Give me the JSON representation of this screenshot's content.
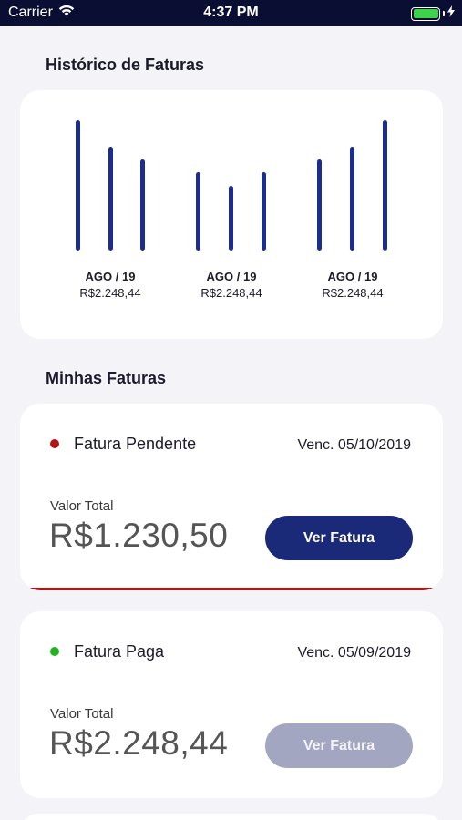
{
  "status_bar": {
    "carrier": "Carrier",
    "time": "4:37 PM",
    "battery_level": 1.0,
    "battery_color": "#3cd24a"
  },
  "history": {
    "title": "Histórico de Faturas",
    "bar_color": "#1b2d8f",
    "groups": [
      {
        "label": "AGO / 19",
        "value": "R$2.248,44",
        "bars": [
          1.0,
          0.8,
          0.7
        ]
      },
      {
        "label": "AGO / 19",
        "value": "R$2.248,44",
        "bars": [
          0.6,
          0.5,
          0.6
        ]
      },
      {
        "label": "AGO / 19",
        "value": "R$2.248,44",
        "bars": [
          0.7,
          0.8,
          1.0
        ]
      }
    ]
  },
  "invoices": {
    "title": "Minhas Faturas",
    "items": [
      {
        "status": "Fatura Pendente",
        "status_color": "#b31414",
        "due": "Venc. 05/10/2019",
        "total_label": "Valor Total",
        "total": "R$1.230,50",
        "button": "Ver Fatura",
        "button_enabled": true
      },
      {
        "status": "Fatura Paga",
        "status_color": "#22b322",
        "due": "Venc. 05/09/2019",
        "total_label": "Valor Total",
        "total": "R$2.248,44",
        "button": "Ver Fatura",
        "button_enabled": false
      }
    ]
  }
}
